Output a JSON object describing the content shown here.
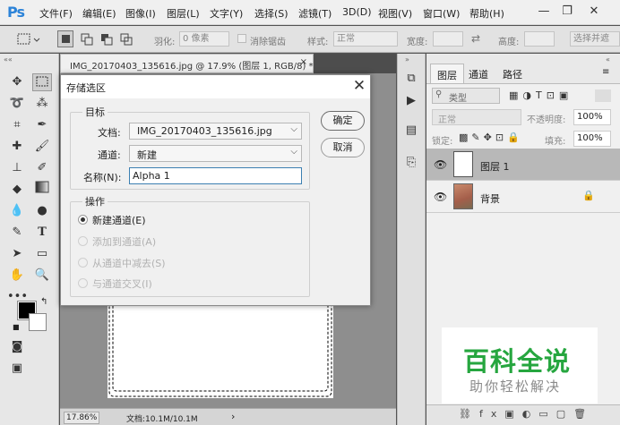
{
  "app": {
    "logo": "Ps"
  },
  "menu": [
    "文件(F)",
    "编辑(E)",
    "图像(I)",
    "图层(L)",
    "文字(Y)",
    "选择(S)",
    "滤镜(T)",
    "3D(D)",
    "视图(V)",
    "窗口(W)",
    "帮助(H)"
  ],
  "window_controls": [
    "—",
    "❐",
    "✕"
  ],
  "options_bar": {
    "feather_label": "羽化:",
    "feather_value": "0 像素",
    "antialias_label": "消除锯齿",
    "style_label": "样式:",
    "style_value": "正常",
    "width_label": "宽度:",
    "height_label": "高度:",
    "select_mask_label": "选择并遮"
  },
  "document": {
    "tab_title": "IMG_20170403_135616.jpg @ 17.9% (图层 1, RGB/8) *",
    "tab_close": "×",
    "zoom": "17.86%",
    "doc_info": "文档:10.1M/10.1M",
    "status_arrow": "›"
  },
  "layers_panel": {
    "tabs": [
      "图层",
      "通道",
      "路径"
    ],
    "filter_label": "类型",
    "blend_mode": "正常",
    "opacity_label": "不透明度:",
    "opacity_value": "100%",
    "lock_label": "锁定:",
    "fill_label": "填充:",
    "fill_value": "100%",
    "layers": [
      {
        "name": "图层 1",
        "selected": true
      },
      {
        "name": "背景",
        "selected": false
      }
    ]
  },
  "dialog": {
    "title": "存储选区",
    "close": "✕",
    "target_group": "目标",
    "document_label": "文档:",
    "document_value": "IMG_20170403_135616.jpg",
    "channel_label": "通道:",
    "channel_value": "新建",
    "name_label": "名称(N):",
    "name_value": "Alpha 1",
    "ok_label": "确定",
    "cancel_label": "取消",
    "operation_group": "操作",
    "operations": [
      {
        "label": "新建通道(E)",
        "selected": true,
        "enabled": true
      },
      {
        "label": "添加到通道(A)",
        "selected": false,
        "enabled": false
      },
      {
        "label": "从通道中减去(S)",
        "selected": false,
        "enabled": false
      },
      {
        "label": "与通道交叉(I)",
        "selected": false,
        "enabled": false
      }
    ]
  },
  "watermark": {
    "main": "百科全说",
    "sub": "助你轻松解决"
  },
  "colors": {
    "accent_ps": "#2c83d8",
    "watermark_green": "#26a63f"
  }
}
